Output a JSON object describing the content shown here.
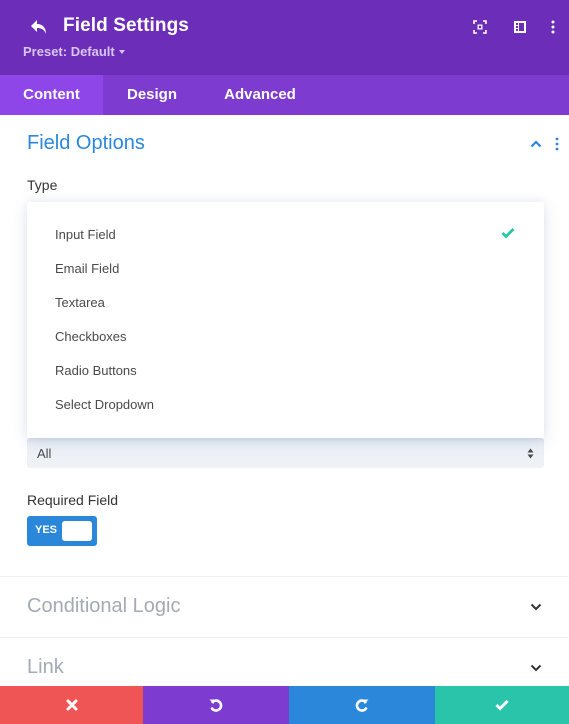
{
  "header": {
    "title": "Field Settings",
    "preset_label": "Preset: Default",
    "icons": [
      "back-icon",
      "focus-mode-icon",
      "split-view-icon",
      "more-options-icon"
    ]
  },
  "tabs": [
    {
      "label": "Content",
      "active": true
    },
    {
      "label": "Design",
      "active": false
    },
    {
      "label": "Advanced",
      "active": false
    }
  ],
  "field_options": {
    "title": "Field Options",
    "expanded": true,
    "type_label": "Type",
    "type_options": [
      {
        "label": "Input Field",
        "selected": true
      },
      {
        "label": "Email Field",
        "selected": false
      },
      {
        "label": "Textarea",
        "selected": false
      },
      {
        "label": "Checkboxes",
        "selected": false
      },
      {
        "label": "Radio Buttons",
        "selected": false
      },
      {
        "label": "Select Dropdown",
        "selected": false
      }
    ],
    "select_value": "All",
    "required_label": "Required Field",
    "required_toggle": {
      "value": true,
      "label": "YES"
    }
  },
  "sections": [
    {
      "title": "Conditional Logic",
      "expanded": false
    },
    {
      "title": "Link",
      "expanded": false
    }
  ],
  "footer": {
    "buttons": [
      {
        "name": "discard",
        "icon": "close-icon",
        "color": "#ef5555"
      },
      {
        "name": "undo",
        "icon": "undo-icon",
        "color": "#7e3bd0"
      },
      {
        "name": "redo",
        "icon": "redo-icon",
        "color": "#2b87da"
      },
      {
        "name": "save",
        "icon": "check-icon",
        "color": "#29c4a9"
      }
    ]
  },
  "colors": {
    "header_bg": "#6c2eb9",
    "tabs_bg": "#7d3bcf",
    "active_tab_bg": "#8e46e8",
    "accent_blue": "#2b87da",
    "check_green": "#29c4a9"
  }
}
